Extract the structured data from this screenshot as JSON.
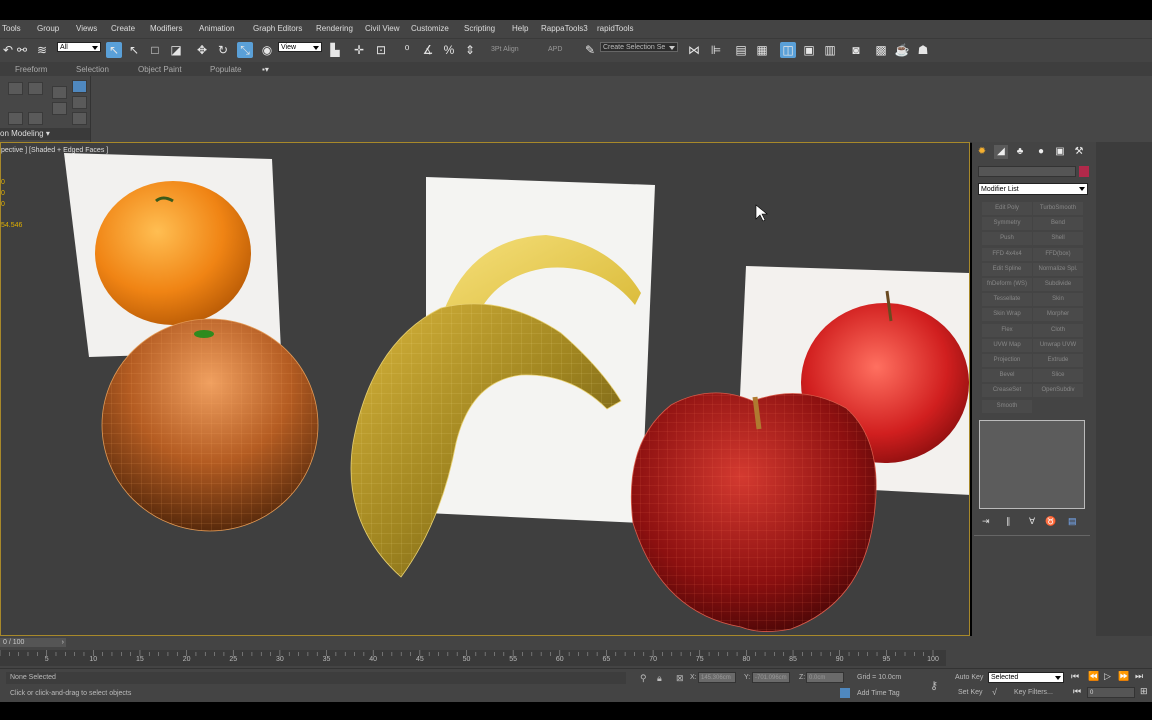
{
  "menu": [
    "Tools",
    "Group",
    "Views",
    "Create",
    "Modifiers",
    "Animation",
    "Graph Editors",
    "Rendering",
    "Civil View",
    "Customize",
    "Scripting",
    "Help",
    "RappaTools3",
    "rapidTools"
  ],
  "toolbar": {
    "selection_filter": "All",
    "reference_coord": "View",
    "align_label": "3Pt Align",
    "apd_label": "APD",
    "named_selection": "Create Selection Se"
  },
  "ribbon": {
    "tabs": [
      "Freeform",
      "Selection",
      "Object Paint",
      "Populate"
    ],
    "panel_label": "on Modeling"
  },
  "viewport": {
    "label": "pective ] [Shaded + Edged Faces ]",
    "coords": [
      "0",
      "0",
      "0",
      "54.546"
    ]
  },
  "command_panel": {
    "modifier_list": "Modifier List",
    "modifiers": [
      [
        "Edit Poly",
        "TurboSmooth"
      ],
      [
        "Symmetry",
        "Bend"
      ],
      [
        "Push",
        "Shell"
      ],
      [
        "FFD 4x4x4",
        "FFD(box)"
      ],
      [
        "Edit Spline",
        "Normalize Spl."
      ],
      [
        "fnDeform (WS)",
        "Subdivide"
      ],
      [
        "Tessellate",
        "Skin"
      ],
      [
        "Skin Wrap",
        "Morpher"
      ],
      [
        "Flex",
        "Cloth"
      ],
      [
        "UVW Map",
        "Unwrap UVW"
      ],
      [
        "Projection",
        "Extrude"
      ],
      [
        "Bevel",
        "Slice"
      ],
      [
        "CreaseSet",
        "OpenSubdiv"
      ],
      [
        "Smooth",
        ""
      ]
    ],
    "color_swatch": "#b0294a"
  },
  "timeline": {
    "slider": "0 / 100",
    "ticks": [
      "5",
      "10",
      "15",
      "20",
      "25",
      "30",
      "35",
      "40",
      "45",
      "50",
      "55",
      "60",
      "65",
      "70",
      "75",
      "80",
      "85",
      "90",
      "95",
      "100"
    ]
  },
  "status": {
    "selection": "None Selected",
    "prompt": "Click or click-and-drag to select objects",
    "x_label": "X:",
    "x_value": "145.306cm",
    "y_label": "Y:",
    "y_value": "-701.096cm",
    "z_label": "Z:",
    "z_value": "0.0cm",
    "grid": "Grid = 10.0cm",
    "add_time_tag": "Add Time Tag",
    "auto_key": "Auto Key",
    "auto_key_mode": "Selected",
    "set_key": "Set Key",
    "key_filters": "Key Filters...",
    "frame": "0"
  }
}
